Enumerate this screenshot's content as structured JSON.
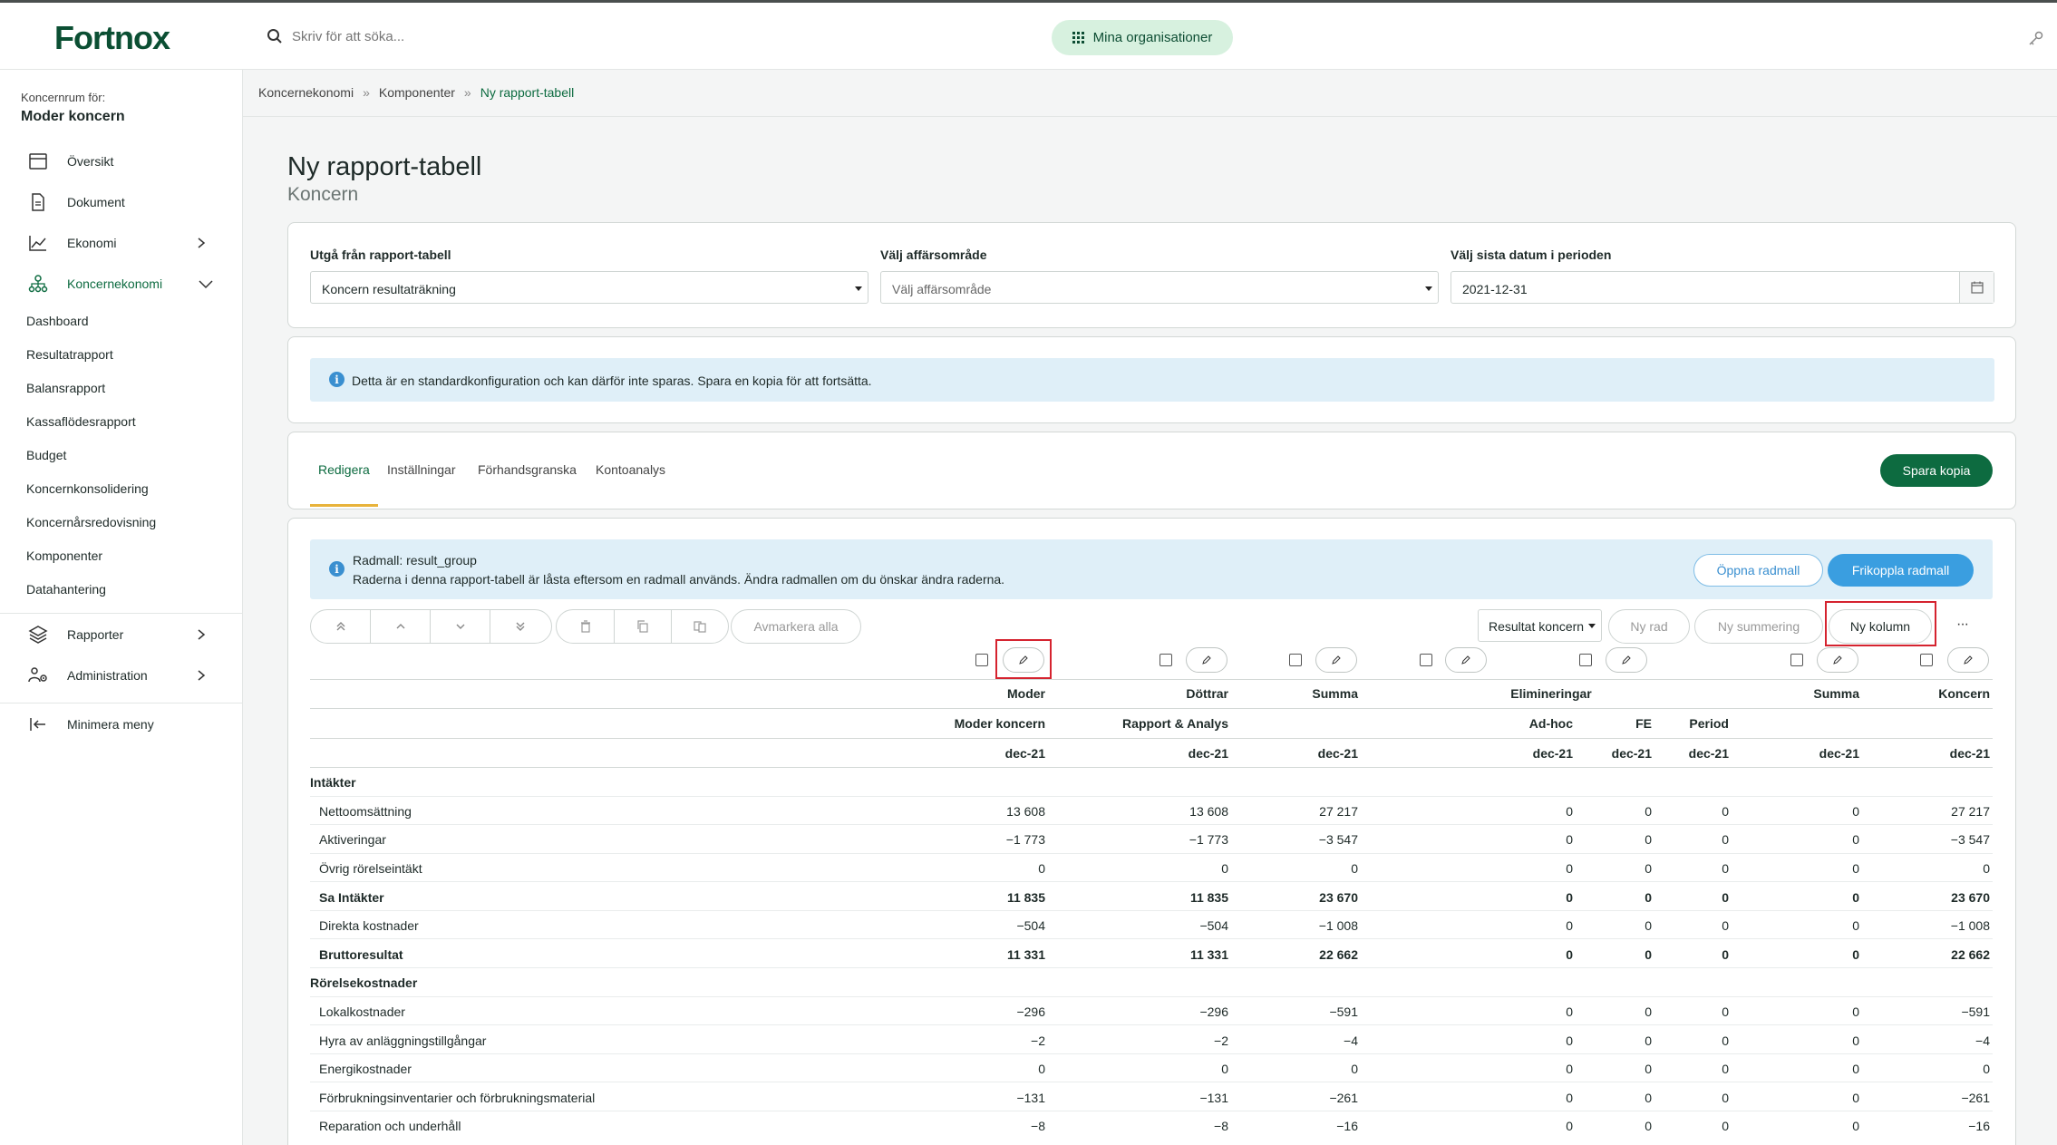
{
  "topbar": {
    "logo": "Fortnox",
    "search_placeholder": "Skriv för att söka...",
    "org_button": "Mina organisationer"
  },
  "sidebar": {
    "caption": "Koncernrum för:",
    "org_name": "Moder koncern",
    "items": [
      {
        "label": "Översikt",
        "icon": "calendar-icon"
      },
      {
        "label": "Dokument",
        "icon": "document-icon"
      },
      {
        "label": "Ekonomi",
        "icon": "chart-line-icon"
      },
      {
        "label": "Koncernekonomi",
        "icon": "group-structure-icon"
      }
    ],
    "sub_items": [
      "Dashboard",
      "Resultatrapport",
      "Balansrapport",
      "Kassaflödesrapport",
      "Budget",
      "Koncernkonsolidering",
      "Koncernårsredovisning",
      "Komponenter",
      "Datahantering"
    ],
    "bottom_items": [
      {
        "label": "Rapporter",
        "icon": "layers-icon"
      },
      {
        "label": "Administration",
        "icon": "users-gear-icon"
      }
    ],
    "minimize": "Minimera meny"
  },
  "breadcrumb": [
    "Koncernekonomi",
    "Komponenter",
    "Ny rapport-tabell"
  ],
  "page": {
    "title": "Ny rapport-tabell",
    "subtitle": "Koncern"
  },
  "filters": {
    "report_label": "Utgå från rapport-tabell",
    "report_value": "Koncern resultaträkning",
    "area_label": "Välj affärsområde",
    "area_placeholder": "Välj affärsområde",
    "date_label": "Välj sista datum i perioden",
    "date_value": "2021-12-31"
  },
  "info_message": "Detta är en standardkonfiguration och kan därför inte sparas. Spara en kopia för att fortsätta.",
  "tabs": [
    "Redigera",
    "Inställningar",
    "Förhandsgranska",
    "Kontoanalys"
  ],
  "save_copy": "Spara kopia",
  "template_info": {
    "title": "Radmall: result_group",
    "text": "Raderna i denna rapport-tabell är låsta eftersom en radmall används. Ändra radmallen om du önskar ändra raderna.",
    "open_button": "Öppna radmall",
    "detach_button": "Frikoppla radmall"
  },
  "toolbar": {
    "deselect_all": "Avmarkera alla",
    "dropdown_value": "Resultat koncern",
    "new_row": "Ny rad",
    "new_sum": "Ny summering",
    "new_column": "Ny kolumn",
    "more": "···"
  },
  "table": {
    "header1": [
      "Moder",
      "Döttrar",
      "Summa",
      "Elimineringar",
      "Summa",
      "Koncern"
    ],
    "header2": [
      "Moder koncern",
      "Rapport & Analys",
      "Ad-hoc",
      "FE",
      "Period"
    ],
    "period": [
      "dec-21",
      "dec-21",
      "dec-21",
      "dec-21",
      "dec-21",
      "dec-21",
      "dec-21",
      "dec-21"
    ],
    "sections": [
      "Intäkter",
      "Rörelsekostnader"
    ],
    "rows": [
      {
        "label": "Nettoomsättning",
        "bold": false,
        "values": [
          "13 608",
          "13 608",
          "27 217",
          "0",
          "0",
          "0",
          "0",
          "27 217"
        ]
      },
      {
        "label": "Aktiveringar",
        "bold": false,
        "values": [
          "−1 773",
          "−1 773",
          "−3 547",
          "0",
          "0",
          "0",
          "0",
          "−3 547"
        ]
      },
      {
        "label": "Övrig rörelseintäkt",
        "bold": false,
        "values": [
          "0",
          "0",
          "0",
          "0",
          "0",
          "0",
          "0",
          "0"
        ]
      },
      {
        "label": "Sa Intäkter",
        "bold": true,
        "values": [
          "11 835",
          "11 835",
          "23 670",
          "0",
          "0",
          "0",
          "0",
          "23 670"
        ]
      },
      {
        "label": "Direkta kostnader",
        "bold": false,
        "values": [
          "−504",
          "−504",
          "−1 008",
          "0",
          "0",
          "0",
          "0",
          "−1 008"
        ]
      },
      {
        "label": "Bruttoresultat",
        "bold": true,
        "values": [
          "11 331",
          "11 331",
          "22 662",
          "0",
          "0",
          "0",
          "0",
          "22 662"
        ]
      },
      {
        "label": "Lokalkostnader",
        "bold": false,
        "values": [
          "−296",
          "−296",
          "−591",
          "0",
          "0",
          "0",
          "0",
          "−591"
        ]
      },
      {
        "label": "Hyra av anläggningstillgångar",
        "bold": false,
        "values": [
          "−2",
          "−2",
          "−4",
          "0",
          "0",
          "0",
          "0",
          "−4"
        ]
      },
      {
        "label": "Energikostnader",
        "bold": false,
        "values": [
          "0",
          "0",
          "0",
          "0",
          "0",
          "0",
          "0",
          "0"
        ]
      },
      {
        "label": "Förbrukningsinventarier och förbrukningsmaterial",
        "bold": false,
        "values": [
          "−131",
          "−131",
          "−261",
          "0",
          "0",
          "0",
          "0",
          "−261"
        ]
      },
      {
        "label": "Reparation och underhåll",
        "bold": false,
        "values": [
          "−8",
          "−8",
          "−16",
          "0",
          "0",
          "0",
          "0",
          "−16"
        ]
      }
    ]
  }
}
